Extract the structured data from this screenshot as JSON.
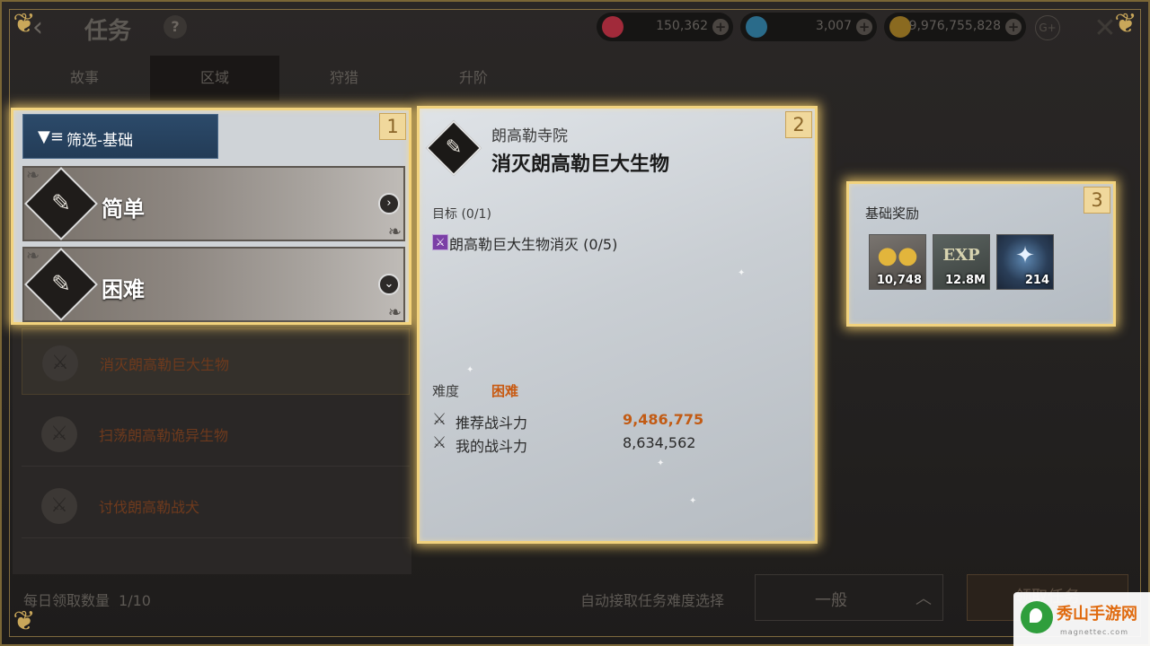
{
  "header": {
    "title": "任务",
    "help": "?",
    "currencies": [
      {
        "icon": "red-gem-icon",
        "color": "#a12a3a",
        "value": "150,362"
      },
      {
        "icon": "blue-diamond-icon",
        "color": "#2a6b8a",
        "value": "3,007"
      },
      {
        "icon": "gold-coin-icon",
        "color": "#8a6a20",
        "value": "9,976,755,828"
      }
    ],
    "gplus": "G+"
  },
  "tabs": [
    {
      "label": "故事",
      "active": false
    },
    {
      "label": "区域",
      "active": true
    },
    {
      "label": "狩猎",
      "active": false
    },
    {
      "label": "升阶",
      "active": false
    }
  ],
  "quest_list": [
    {
      "label": "消灭朗高勒巨大生物",
      "selected": true
    },
    {
      "label": "扫荡朗高勒诡异生物",
      "selected": false
    },
    {
      "label": "讨伐朗高勒战犬",
      "selected": false
    }
  ],
  "daily": {
    "label": "每日领取数量",
    "value": "1/10"
  },
  "box1": {
    "badge": "1",
    "filter_label": "筛选-基础",
    "difficulties": [
      {
        "label": "简单"
      },
      {
        "label": "困难"
      }
    ]
  },
  "box2": {
    "badge": "2",
    "location": "朗高勒寺院",
    "title": "消灭朗高勒巨大生物",
    "goal": "目标 (0/1)",
    "objective": "朗高勒巨大生物消灭 (0/5)",
    "difficulty_label": "难度",
    "difficulty_value": "困难",
    "recommended_label": "推荐战斗力",
    "recommended_value": "9,486,775",
    "my_power_label": "我的战斗力",
    "my_power_value": "8,634,562"
  },
  "box3": {
    "badge": "3",
    "title": "基础奖励",
    "rewards": [
      {
        "icon": "gold-coins-icon",
        "value": "10,748"
      },
      {
        "icon": "exp-icon",
        "value": "12.8M"
      },
      {
        "icon": "blue-orb-icon",
        "value": "214"
      }
    ]
  },
  "bottom": {
    "auto_label": "自动接取任务难度选择",
    "select_value": "一般",
    "accept_label": "领取任务"
  },
  "watermark": {
    "text": "秀山手游网",
    "sub": "magnettec.com"
  }
}
